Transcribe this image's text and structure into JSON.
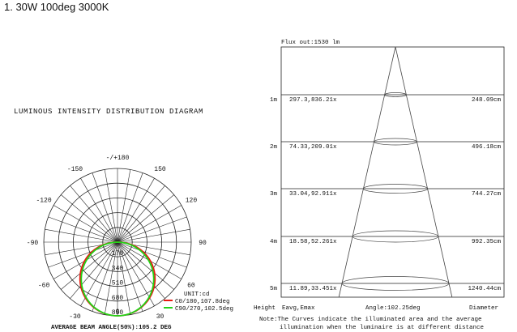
{
  "header": {
    "title": "1. 30W 100deg 3000K"
  },
  "polar": {
    "title": "LUMINOUS INTENSITY DISTRIBUTION DIAGRAM",
    "angle_labels": [
      "-/+180",
      "-150",
      "150",
      "-120",
      "120",
      "-90",
      "90",
      "-60",
      "60",
      "-30",
      "30",
      "0"
    ],
    "radial_labels": [
      "170",
      "340",
      "510",
      "680",
      "850"
    ],
    "unit": "UNIT:cd",
    "legend": [
      {
        "label": "C0/180,107.8deg",
        "color": "#e8190f"
      },
      {
        "label": "C90/270,102.5deg",
        "color": "#23d319"
      }
    ],
    "beam_angle_text": "AVERAGE BEAM ANGLE(50%):105.2 DEG"
  },
  "cone": {
    "flux": "Flux out:1530 lm",
    "rows": [
      {
        "height": "1m",
        "eavg_emax": "297.3,836.21x",
        "diameter": "248.09cm"
      },
      {
        "height": "2m",
        "eavg_emax": "74.33,209.01x",
        "diameter": "496.18cm"
      },
      {
        "height": "3m",
        "eavg_emax": "33.04,92.911x",
        "diameter": "744.27cm"
      },
      {
        "height": "4m",
        "eavg_emax": "18.58,52.261x",
        "diameter": "992.35cm"
      },
      {
        "height": "5m",
        "eavg_emax": "11.89,33.451x",
        "diameter": "1240.44cm"
      }
    ],
    "footer": {
      "height": "Height",
      "eavg_emax": "Eavg,Emax",
      "angle": "Angle:102.25deg",
      "diameter": "Diameter"
    },
    "note_line1": "Note:The Curves indicate the illuminated area and the average",
    "note_line2": "illumination when the luminaire is at different distance"
  }
}
